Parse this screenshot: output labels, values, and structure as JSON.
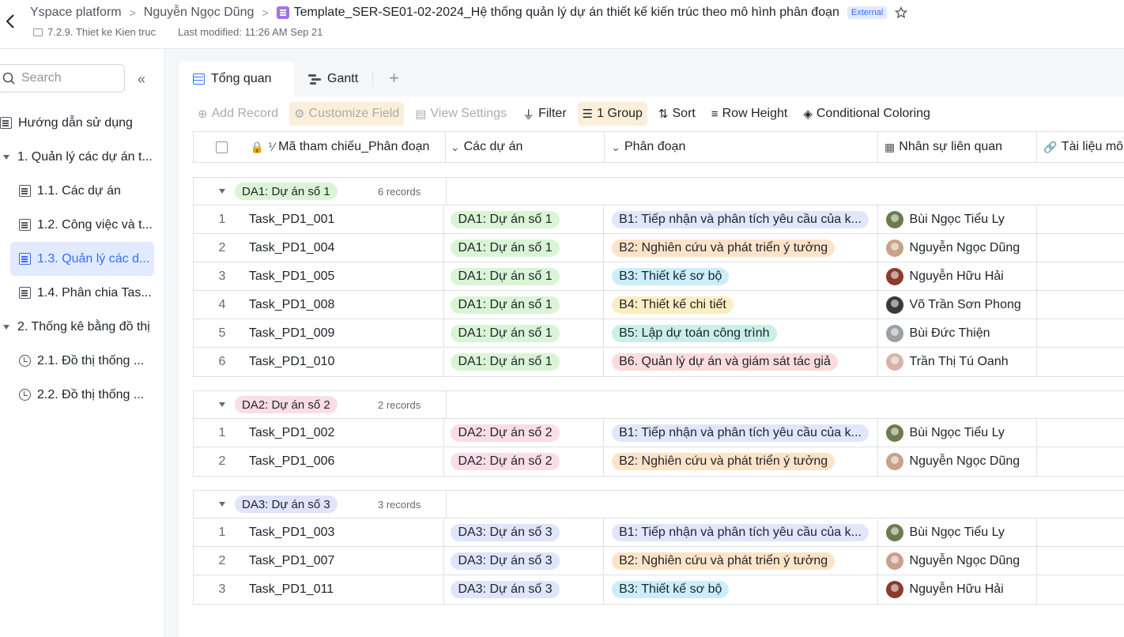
{
  "header": {
    "breadcrumbs": [
      "Yspace platform",
      "Nguyễn Ngọc Dũng"
    ],
    "doc_title": "Template_SER-SE01-02-2024_Hệ thống quản lý dự án thiết kế kiến trúc theo mô hình phân đoạn",
    "badge": "External",
    "folder": "7.2.9. Thiet ke Kien truc",
    "last_modified": "Last modified: 11:26 AM Sep 21"
  },
  "sidebar": {
    "search_placeholder": "Search",
    "items": [
      {
        "label": "Hướng dẫn sử dụng"
      },
      {
        "label": "1. Quản lý các dự án t..."
      },
      {
        "label": "1.1. Các dự án"
      },
      {
        "label": "1.2. Công việc và t..."
      },
      {
        "label": "1.3. Quản lý các d..."
      },
      {
        "label": "1.4. Phân chia Tas..."
      },
      {
        "label": "2. Thống kê bằng đồ thị"
      },
      {
        "label": "2.1. Đồ thị thống ..."
      },
      {
        "label": "2.2. Đồ thị thống ..."
      }
    ]
  },
  "tabs": [
    {
      "label": "Tổng quan"
    },
    {
      "label": "Gantt"
    }
  ],
  "toolbar": {
    "add_record": "Add Record",
    "customize_field": "Customize Field",
    "view_settings": "View Settings",
    "filter": "Filter",
    "group": "1 Group",
    "sort": "Sort",
    "row_height": "Row Height",
    "conditional_coloring": "Conditional Coloring"
  },
  "columns": {
    "id": "Mã tham chiếu_Phân đoạn",
    "project": "Các dự án",
    "phase": "Phân đoạn",
    "people": "Nhân sự liên quan",
    "docs": "Tài liệu mô"
  },
  "colors": {
    "accent": "#3370ff",
    "da1": "#d9f5d6",
    "da2": "#fbdde7",
    "da3": "#dfe5fa",
    "b1": "#e1e6fb",
    "b2": "#fde3c8",
    "b3": "#cbeefa",
    "b4": "#fbeec3",
    "b5": "#c9f0e8",
    "b6": "#fbdcdc"
  },
  "groups": [
    {
      "label": "DA1: Dự án số 1",
      "count": "6 records",
      "color_key": "da1",
      "rows": [
        {
          "n": "1",
          "id": "Task_PD1_001",
          "project": "DA1: Dự án số 1",
          "phase": "B1: Tiếp nhận và phân tích yêu cầu của k...",
          "phase_key": "b1",
          "person": "Bùi Ngọc Tiểu Ly"
        },
        {
          "n": "2",
          "id": "Task_PD1_004",
          "project": "DA1: Dự án số 1",
          "phase": "B2: Nghiên cứu và phát triển ý tưởng",
          "phase_key": "b2",
          "person": "Nguyễn Ngọc Dũng"
        },
        {
          "n": "3",
          "id": "Task_PD1_005",
          "project": "DA1: Dự án số 1",
          "phase": "B3: Thiết kế sơ bộ",
          "phase_key": "b3",
          "person": "Nguyễn Hữu Hải"
        },
        {
          "n": "4",
          "id": "Task_PD1_008",
          "project": "DA1: Dự án số 1",
          "phase": "B4: Thiết kế chi tiết",
          "phase_key": "b4",
          "person": "Võ Trần Sơn Phong"
        },
        {
          "n": "5",
          "id": "Task_PD1_009",
          "project": "DA1: Dự án số 1",
          "phase": "B5: Lập dự toán công trình",
          "phase_key": "b5",
          "person": "Bùi Đức Thiện"
        },
        {
          "n": "6",
          "id": "Task_PD1_010",
          "project": "DA1: Dự án số 1",
          "phase": "B6. Quản lý dự án và giám sát tác giả",
          "phase_key": "b6",
          "person": "Trần Thị Tú Oanh"
        }
      ]
    },
    {
      "label": "DA2: Dự án số 2",
      "count": "2 records",
      "color_key": "da2",
      "rows": [
        {
          "n": "1",
          "id": "Task_PD1_002",
          "project": "DA2: Dự án số 2",
          "phase": "B1: Tiếp nhận và phân tích yêu cầu của k...",
          "phase_key": "b1",
          "person": "Bùi Ngọc Tiểu Ly"
        },
        {
          "n": "2",
          "id": "Task_PD1_006",
          "project": "DA2: Dự án số 2",
          "phase": "B2: Nghiên cứu và phát triển ý tưởng",
          "phase_key": "b2",
          "person": "Nguyễn Ngọc Dũng"
        }
      ]
    },
    {
      "label": "DA3: Dự án số 3",
      "count": "3 records",
      "color_key": "da3",
      "rows": [
        {
          "n": "1",
          "id": "Task_PD1_003",
          "project": "DA3: Dự án số 3",
          "phase": "B1: Tiếp nhận và phân tích yêu cầu của k...",
          "phase_key": "b1",
          "person": "Bùi Ngọc Tiểu Ly"
        },
        {
          "n": "2",
          "id": "Task_PD1_007",
          "project": "DA3: Dự án số 3",
          "phase": "B2: Nghiên cứu và phát triển ý tưởng",
          "phase_key": "b2",
          "person": "Nguyễn Ngọc Dũng"
        },
        {
          "n": "3",
          "id": "Task_PD1_011",
          "project": "DA3: Dự án số 3",
          "phase": "B3: Thiết kế sơ bộ",
          "phase_key": "b3",
          "person": "Nguyễn Hữu Hải"
        }
      ]
    }
  ]
}
